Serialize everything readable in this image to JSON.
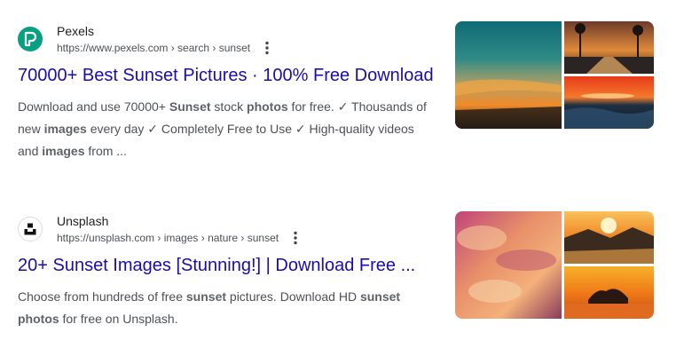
{
  "results": [
    {
      "site_name": "Pexels",
      "url": "https://www.pexels.com › search › sunset",
      "title": "70000+ Best Sunset Pictures · 100% Free Download",
      "snippet": [
        {
          "t": "Download and use 70000+ ",
          "b": false
        },
        {
          "t": "Sunset",
          "b": true
        },
        {
          "t": " stock ",
          "b": false
        },
        {
          "t": "photos",
          "b": true
        },
        {
          "t": " for free. ✓ Thousands of new ",
          "b": false
        },
        {
          "t": "images",
          "b": true
        },
        {
          "t": " every day ✓ Completely Free to Use ✓ High-quality videos and ",
          "b": false
        },
        {
          "t": "images",
          "b": true
        },
        {
          "t": " from ...",
          "b": false
        }
      ],
      "favicon_icon": "pexels-logo-icon",
      "thumbnails": [
        "teal-orange-sunset-sky",
        "palm-sunset-road",
        "ocean-sunset-waves"
      ]
    },
    {
      "site_name": "Unsplash",
      "url": "https://unsplash.com › images › nature › sunset",
      "title": "20+ Sunset Images [Stunning!] | Download Free ...",
      "snippet": [
        {
          "t": "Choose from hundreds of free ",
          "b": false
        },
        {
          "t": "sunset",
          "b": true
        },
        {
          "t": " pictures. Download HD ",
          "b": false
        },
        {
          "t": "sunset photos",
          "b": true
        },
        {
          "t": " for free on Unsplash.",
          "b": false
        }
      ],
      "favicon_icon": "unsplash-logo-icon",
      "thumbnails": [
        "pink-cloud-sunset",
        "mountain-sunset-field",
        "lake-sunset-trees"
      ]
    }
  ],
  "colors": {
    "link": "#1a0dab",
    "snippet": "#4d5156",
    "pexels_brand": "#05a081"
  }
}
